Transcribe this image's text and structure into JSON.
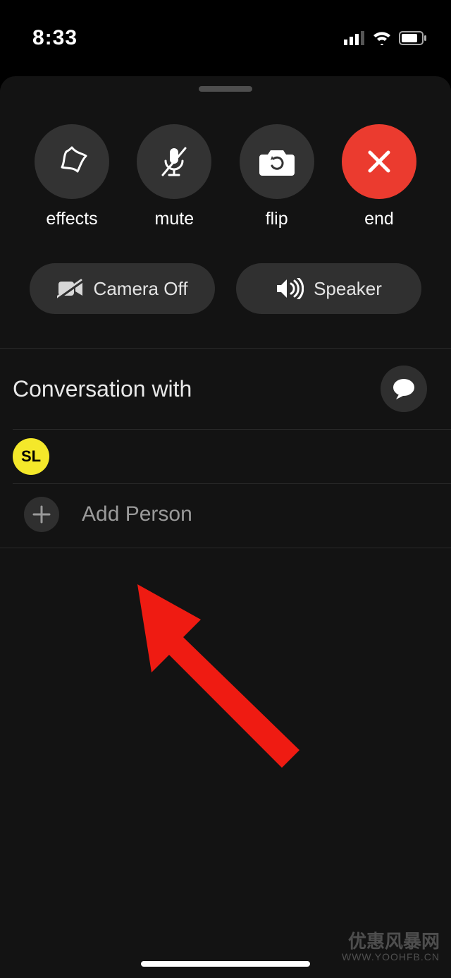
{
  "status": {
    "time": "8:33"
  },
  "actions": {
    "effects": "effects",
    "mute": "mute",
    "flip": "flip",
    "end": "end"
  },
  "pills": {
    "camera_off": "Camera Off",
    "speaker": "Speaker"
  },
  "conversation": {
    "title": "Conversation with",
    "participant_initials": "SL",
    "add_person": "Add Person"
  },
  "watermark": {
    "line1": "优惠风暴网",
    "line2": "WWW.YOOHFB.CN"
  }
}
